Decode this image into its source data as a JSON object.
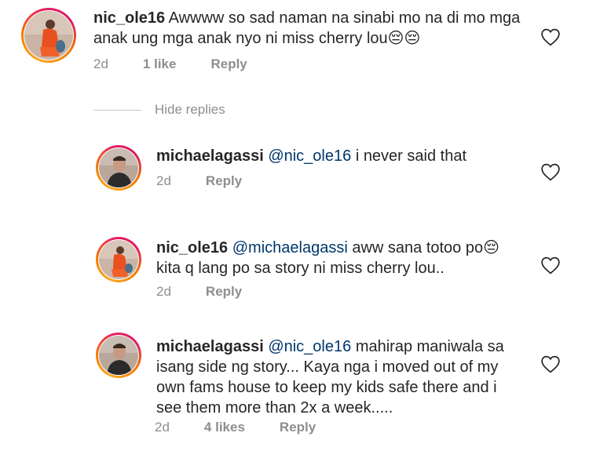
{
  "comments": [
    {
      "username": "nic_ole16",
      "text": "Awwww so sad naman na sinabi mo na di mo mga anak ung mga anak nyo ni miss cherry lou",
      "emoji": "😔😔",
      "time": "2d",
      "likes": "1 like",
      "reply": "Reply"
    }
  ],
  "hide_replies_label": "Hide replies",
  "replies": [
    {
      "username": "michaelagassi",
      "mention": "@nic_ole16",
      "text": "i never said that",
      "time": "2d",
      "reply": "Reply"
    },
    {
      "username": "nic_ole16",
      "mention": "@michaelagassi",
      "text_line1": "aww sana totoo po",
      "emoji": "😔",
      "text_line2": "kita q lang po sa story ni miss cherry lou..",
      "time": "2d",
      "reply": "Reply"
    },
    {
      "username": "michaelagassi",
      "mention": "@nic_ole16",
      "text_line1": "mahirap maniwala sa",
      "text_line2": "isang side ng story... Kaya nga i moved out of my",
      "text_line3": "own fams house to keep my kids safe there and i",
      "text_line4": "see them more than 2x a week.....",
      "time": "2d",
      "likes": "4 likes",
      "reply": "Reply"
    }
  ],
  "colors": {
    "text": "#262626",
    "meta": "#8e8e8e",
    "mention": "#00376b",
    "ring_start": "#f9a825",
    "ring_end": "#d81b60"
  },
  "icons": {
    "like": "heart-outline-icon"
  }
}
